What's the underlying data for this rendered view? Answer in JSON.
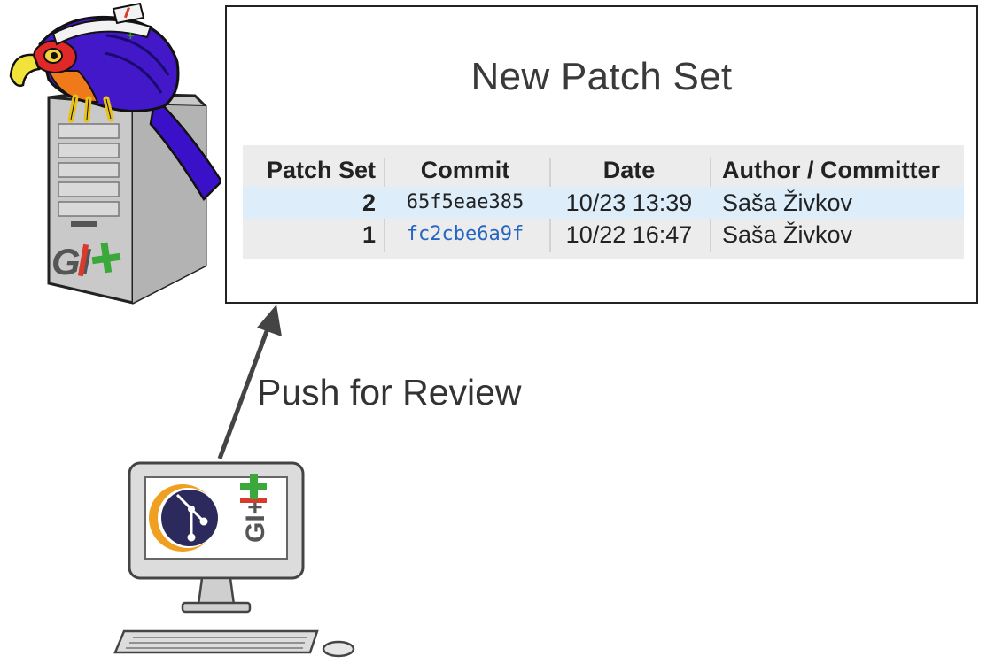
{
  "panel": {
    "title": "New Patch Set",
    "table": {
      "headers": [
        "Patch Set",
        "Commit",
        "Date",
        "Author / Committer"
      ],
      "rows": [
        {
          "patch_set": "2",
          "commit": "65f5eae385",
          "date": "10/23 13:39",
          "author": "Saša Živkov"
        },
        {
          "patch_set": "1",
          "commit": "fc2cbe6a9f",
          "date": "10/22 16:47",
          "author": "Saša Živkov"
        }
      ]
    }
  },
  "arrow_label": "Push for Review",
  "icons": {
    "server": "gerrit-server-icon",
    "mascot": "gerrit-bird-icon",
    "computer": "desktop-computer-icon",
    "egit_logo": "egit-logo-icon",
    "gerrit_logo": "gerrit-logo-icon"
  },
  "logo_text": "GI+",
  "colors": {
    "selected_row": "#ddeefa",
    "table_bg": "#ececec",
    "link": "#2565c4",
    "gerrit_green": "#3aa83a",
    "gerrit_red": "#d93a2b"
  }
}
